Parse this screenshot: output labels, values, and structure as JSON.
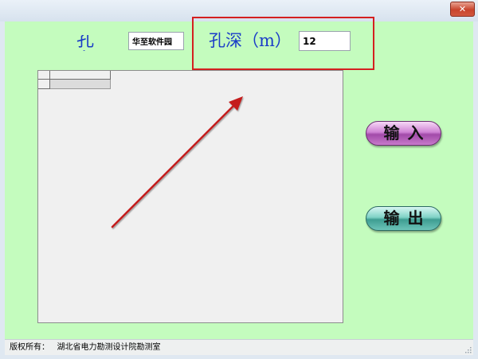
{
  "window": {
    "close_glyph": "✕"
  },
  "form": {
    "borehole_label": "孔名",
    "borehole_value": "华至软件园",
    "depth_label": "孔深（m）",
    "depth_value": "12"
  },
  "buttons": {
    "input_label": "输入",
    "output_label": "输出"
  },
  "statusbar": {
    "text": "版权所有：   湖北省电力勘测设计院勘测室"
  },
  "colors": {
    "client_bg": "#c4fcbe",
    "label_blue": "#1a3cc8",
    "highlight_red": "#d42020",
    "arrow_red": "#c41e1e",
    "input_button": "#c77acb",
    "output_button": "#6cc4b8"
  },
  "icons": {
    "close": "close-icon",
    "resize": "resize-grip-icon",
    "annotation": "arrow-icon"
  }
}
